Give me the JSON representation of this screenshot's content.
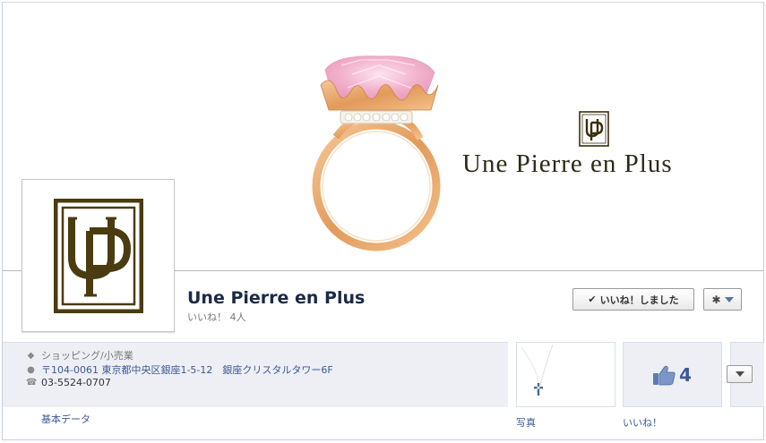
{
  "cover": {
    "brand_name": "Une Pierre en Plus"
  },
  "header": {
    "page_name": "Une Pierre en Plus",
    "likes_line": "いいね！ 4人"
  },
  "actions": {
    "liked_label": "いいね！しました",
    "gear_icon": "gear-icon"
  },
  "info": {
    "category": "ショッピング/小売業",
    "address": "〒104-0061 東京都中央区銀座1-5-12　銀座クリスタルタワー6F",
    "phone": "03-5524-0707",
    "basic_data_label": "基本データ"
  },
  "tiles": {
    "photos_label": "写真",
    "likes_label": "いいね！",
    "likes_count": "4"
  },
  "colors": {
    "fb_link": "#3b5998",
    "logo_brown": "#4a3c10",
    "gold": "#e8a86a",
    "pink_gem": "#f3b9cf"
  }
}
